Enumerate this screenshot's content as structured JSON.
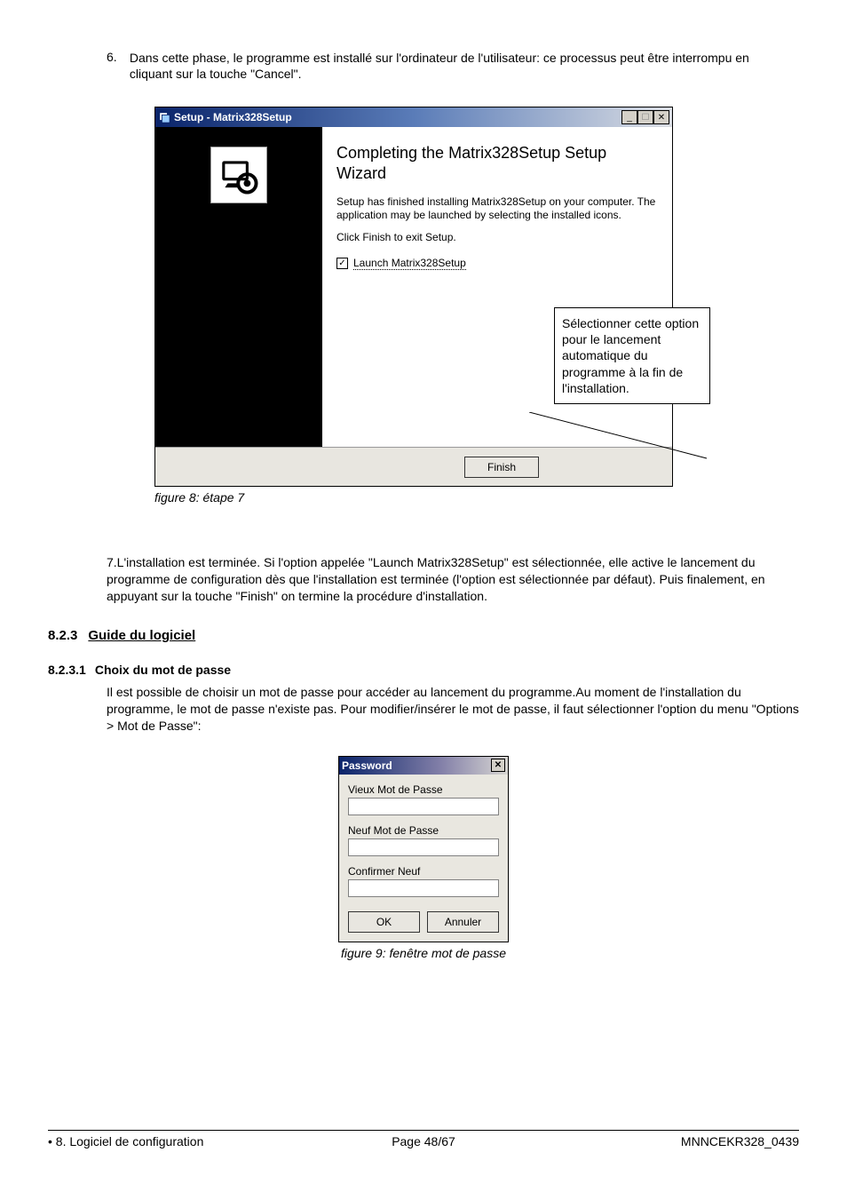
{
  "para6": {
    "num": "6.",
    "text": "Dans cette phase, le programme est installé sur l'ordinateur de l'utilisateur: ce processus peut être interrompu en cliquant sur la touche \"Cancel\"."
  },
  "wizard": {
    "title": "Setup - Matrix328Setup",
    "heading": "Completing the Matrix328Setup Setup Wizard",
    "body1": "Setup has finished installing Matrix328Setup on your computer. The application may be launched by selecting the installed icons.",
    "body2": "Click Finish to exit Setup.",
    "checkbox_label": "Launch Matrix328Setup",
    "finish": "Finish",
    "min": "_",
    "max": "☐",
    "close": "✕"
  },
  "callout": "Sélectionner cette option pour le lancement automatique du programme à la fin de l'installation.",
  "caption8": "figure 8: étape 7",
  "para7": "7.L'installation est terminée. Si l'option appelée \"Launch Matrix328Setup\" est sélectionnée, elle active le lancement du programme de configuration dès que l'installation est terminée (l'option est sélectionnée par défaut). Puis finalement, en appuyant sur la touche \"Finish\" on termine la procédure d'installation.",
  "h823": {
    "num": "8.2.3",
    "text": "Guide du logiciel"
  },
  "h8231": {
    "num": "8.2.3.1",
    "text": "Choix du mot de passe"
  },
  "p8231": "Il est possible de choisir un mot de passe pour accéder au lancement du programme.Au moment de l'installation du programme, le mot de passe n'existe pas.  Pour modifier/insérer le mot de passe, il faut sélectionner l'option du menu \"Options > Mot de Passe\":",
  "pw": {
    "title": "Password",
    "old": "Vieux Mot de Passe",
    "new": "Neuf Mot de Passe",
    "confirm": "Confirmer Neuf",
    "ok": "OK",
    "cancel": "Annuler",
    "close": "✕"
  },
  "caption9": "figure 9: fenêtre mot de passe",
  "footer": {
    "left": "8. Logiciel de configuration",
    "center": "Page 48/67",
    "right": "MNNCEKR328_0439"
  }
}
